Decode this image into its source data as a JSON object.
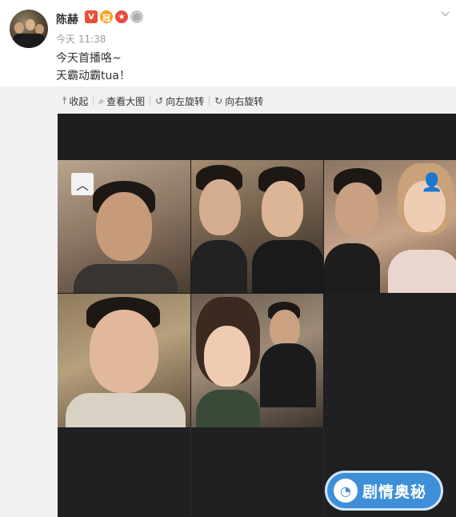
{
  "post": {
    "username": "陈赫",
    "time": "今天 11:38",
    "content_line1": "今天首播咯~",
    "content_line2": "天霸动霸tua！",
    "badges": [
      "V",
      "冠",
      "★",
      "◎"
    ]
  },
  "toolbar": {
    "collapse_label": "收起",
    "view_large_label": "查看大图",
    "rotate_left_label": "向左旋转",
    "rotate_right_label": "向右旋转"
  },
  "viewer": {
    "collapse_icon": "chevron-up-icon",
    "add_user_icon": "add-user-icon"
  },
  "watermark": {
    "text": "剧情奥秘"
  },
  "colors": {
    "viewer_bg": "#1c1c1e",
    "media_bg": "#f1f1f1",
    "watermark_bg": "#3d8fd8",
    "verified_red": "#e8503a"
  }
}
